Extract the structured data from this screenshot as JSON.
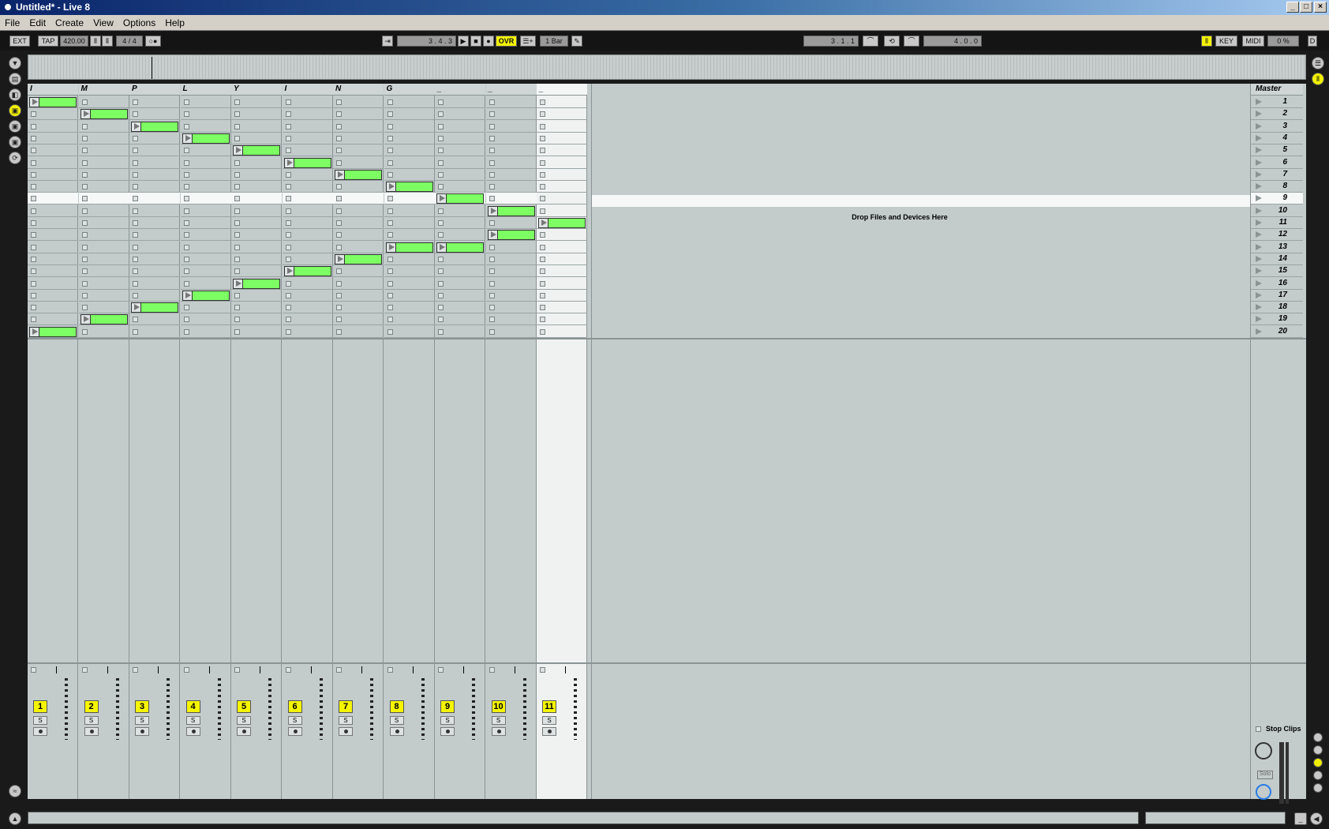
{
  "window": {
    "title": "Untitled* - Live 8"
  },
  "menu": [
    "File",
    "Edit",
    "Create",
    "View",
    "Options",
    "Help"
  ],
  "control_bar": {
    "ext": "EXT",
    "tap": "TAP",
    "tempo": "420.00",
    "time_sig": "4 / 4",
    "position": "3 .   4 .   3",
    "ovr": "OVR",
    "quantize": "1 Bar",
    "loop_start": "3 .   1 .   1",
    "loop_length": "4 .   0 .   0",
    "key": "KEY",
    "midi": "MIDI",
    "cpu": "0 %",
    "disk": "D"
  },
  "tracks": [
    {
      "name": "I",
      "number": "1",
      "clips": [
        1,
        20
      ]
    },
    {
      "name": "M",
      "number": "2",
      "clips": [
        2,
        19
      ]
    },
    {
      "name": "P",
      "number": "3",
      "clips": [
        3,
        18
      ]
    },
    {
      "name": "L",
      "number": "4",
      "clips": [
        4,
        17
      ]
    },
    {
      "name": "Y",
      "number": "5",
      "clips": [
        5,
        16
      ]
    },
    {
      "name": "I",
      "number": "6",
      "clips": [
        6,
        15
      ]
    },
    {
      "name": "N",
      "number": "7",
      "clips": [
        7,
        14
      ]
    },
    {
      "name": "G",
      "number": "8",
      "clips": [
        8,
        13
      ]
    },
    {
      "name": "_",
      "number": "9",
      "clips": [
        9,
        13
      ]
    },
    {
      "name": "_",
      "number": "10",
      "clips": [
        10,
        12
      ]
    },
    {
      "name": "_",
      "number": "11",
      "clips": [
        11
      ]
    }
  ],
  "selected_track": 10,
  "highlighted_scene": 9,
  "scene_count": 20,
  "master": {
    "name": "Master",
    "scenes": [
      "1",
      "2",
      "3",
      "4",
      "5",
      "6",
      "7",
      "8",
      "9",
      "10",
      "11",
      "12",
      "13",
      "14",
      "15",
      "16",
      "17",
      "18",
      "19",
      "20"
    ],
    "stop_clips": "Stop Clips",
    "solo": "Solo"
  },
  "drop_zone": {
    "text": "Drop Files and Devices Here"
  },
  "mixer": {
    "solo_label": "S"
  },
  "colors": {
    "clip": "#7dff63",
    "track_number": "#f5f500",
    "session_bg": "#c3cbcb"
  }
}
